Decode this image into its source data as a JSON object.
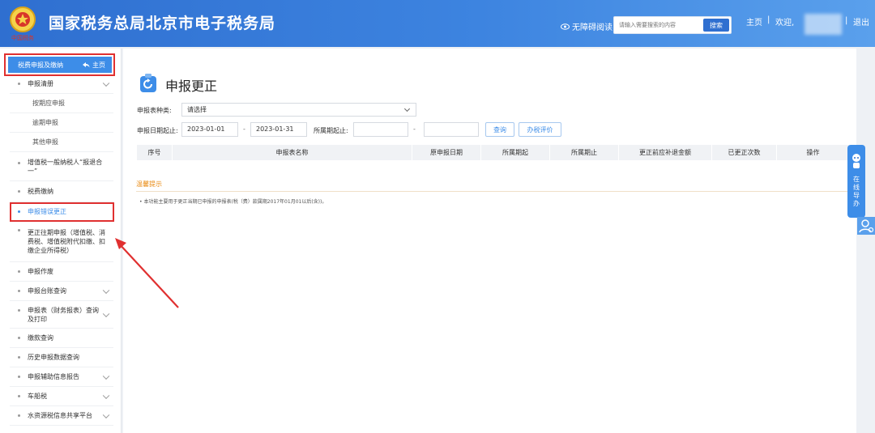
{
  "header": {
    "title": "国家税务总局北京市电子税务局",
    "emblem_text": "中国税务",
    "accessibility_label": "无障碍阅读",
    "search_placeholder": "请输入需要搜索的内容",
    "search_button": "搜索",
    "home_link": "主页",
    "separator": "|",
    "welcome": "欢迎,",
    "logout": "退出"
  },
  "sidebar": {
    "top": {
      "label": "税费申报及缴纳",
      "home_label": "主页"
    },
    "items": [
      {
        "label": "申报清册",
        "type": "group",
        "chevron": true
      },
      {
        "label": "按期应申报",
        "type": "sub"
      },
      {
        "label": "逾期申报",
        "type": "sub"
      },
      {
        "label": "其他申报",
        "type": "sub"
      },
      {
        "label": "增值税一般纳税人“报退合一”",
        "type": "item"
      },
      {
        "label": "税费缴纳",
        "type": "item"
      },
      {
        "label": "申报错误更正",
        "type": "item",
        "active": true
      },
      {
        "label": "更正往期申报（增值税、消费税、增值税附代扣缴、扣缴企业所得税）",
        "type": "item"
      },
      {
        "label": "申报作废",
        "type": "item"
      },
      {
        "label": "申报台账查询",
        "type": "item",
        "chevron": true
      },
      {
        "label": "申报表（财务报表）查询及打印",
        "type": "item",
        "chevron": true
      },
      {
        "label": "缴款查询",
        "type": "item"
      },
      {
        "label": "历史申报数据查询",
        "type": "item"
      },
      {
        "label": "申报辅助信息报告",
        "type": "item",
        "chevron": true
      },
      {
        "label": "车船税",
        "type": "item",
        "chevron": true
      },
      {
        "label": "水资源税信息共享平台",
        "type": "item",
        "chevron": true
      }
    ]
  },
  "main": {
    "title": "申报更正",
    "form": {
      "type_label": "申报表种类:",
      "type_value": "请选择",
      "date_label": "申报日期起止:",
      "date_from": "2023-01-01",
      "date_to": "2023-01-31",
      "dash": "-",
      "period_label": "所属期起止:",
      "period_from": "",
      "period_to": "",
      "query_button": "查询",
      "evaluate_button": "办税评价"
    },
    "table": {
      "columns": [
        "序号",
        "申报表名称",
        "原申报日期",
        "所属期起",
        "所属期止",
        "更正前应补退金额",
        "已更正次数",
        "操作"
      ]
    },
    "tip": {
      "title": "温馨提示",
      "text": "• 本功能主要用于更正当期已申报的申报表(税（费）款属期2017年01月01以后(含))。"
    }
  },
  "float": {
    "guide_label": "在线导办"
  },
  "colors": {
    "header_blue": "#2f6fd0",
    "accent": "#3d8de8",
    "highlight_red": "#e03030",
    "tip_orange": "#e98a12"
  }
}
